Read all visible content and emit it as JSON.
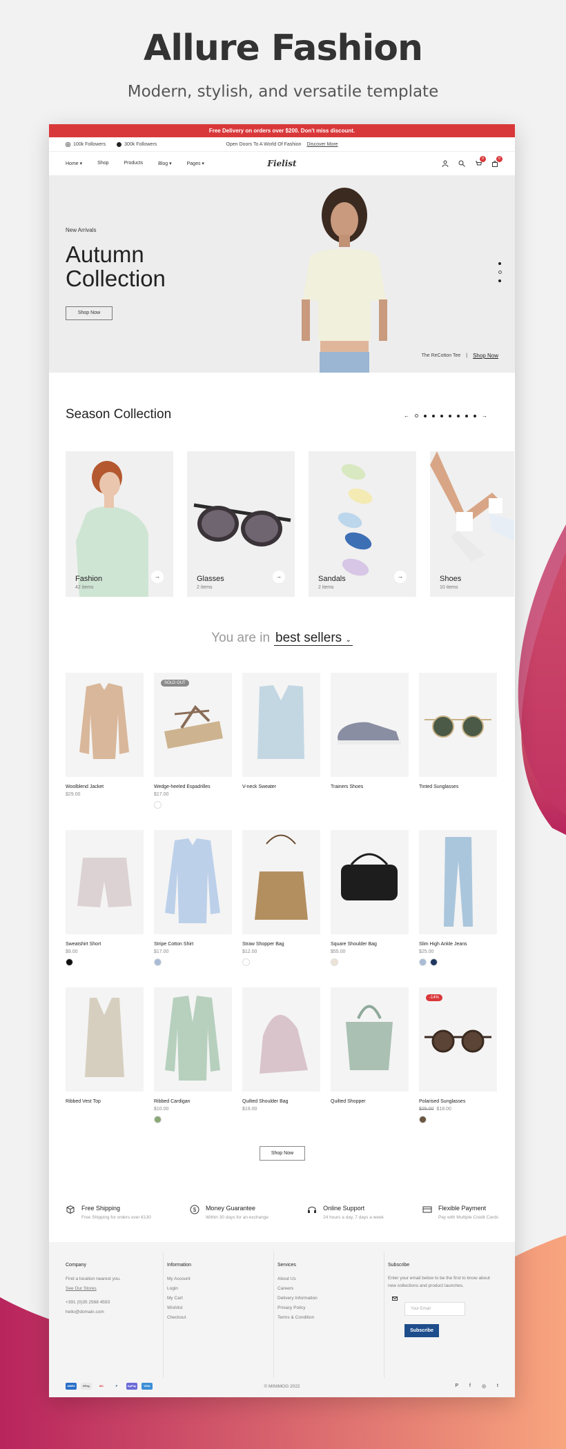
{
  "page": {
    "title": "Allure Fashion",
    "subtitle": "Modern, stylish, and versatile template"
  },
  "promo_bar": {
    "text": "Free Delivery on orders over $200. Don't miss discount."
  },
  "topbar": {
    "followers_1": "100k Followers",
    "followers_2": "300k Followers",
    "center_text": "Open Doors To A World Of Fashion",
    "center_link": "Discover More"
  },
  "nav": {
    "items": [
      "Home",
      "Shop",
      "Products",
      "Blog",
      "Pages"
    ],
    "logo": "Fielist",
    "wishlist_count": "0",
    "cart_count": "0"
  },
  "banner": {
    "eyebrow": "New Arrivals",
    "title_line1": "Autumn",
    "title_line2": "Collection",
    "button": "Shop Now",
    "caption": "The ReCotton Tee",
    "caption_link": "Shop Now"
  },
  "season": {
    "title": "Season Collection",
    "cards": [
      {
        "label": "Fashion",
        "count": "42 items"
      },
      {
        "label": "Glasses",
        "count": "2 items"
      },
      {
        "label": "Sandals",
        "count": "2 items"
      },
      {
        "label": "Shoes",
        "count": "10 items"
      }
    ]
  },
  "bestsellers": {
    "prefix": "You are in",
    "selected": "best sellers"
  },
  "products": [
    {
      "name": "Woolblend Jacket",
      "price": "$29.00",
      "icon": "jacket-icon",
      "swatches": []
    },
    {
      "name": "Wedge-heeled Espadrilles",
      "price": "$17.00",
      "icon": "espadrille-icon",
      "tag": "SOLD OUT",
      "swatches": [
        "#ffffff"
      ]
    },
    {
      "name": "V-neck Sweater",
      "price": "",
      "icon": "sweater-icon",
      "swatches": []
    },
    {
      "name": "Trainers Shoes",
      "price": "",
      "icon": "trainers-icon",
      "swatches": []
    },
    {
      "name": "Tinted Sunglasses",
      "price": "",
      "icon": "sunglasses-icon",
      "swatches": []
    },
    {
      "name": "Sweatshirt Short",
      "price": "$9.00",
      "icon": "shorts-icon",
      "swatches": [
        "#111111"
      ]
    },
    {
      "name": "Stripe Cotton Shirt",
      "price": "$17.00",
      "icon": "shirt-icon",
      "swatches": [
        "#a9bcd6"
      ]
    },
    {
      "name": "Straw Shopper Bag",
      "price": "$12.00",
      "icon": "straw-bag-icon",
      "swatches": [
        "#ffffff"
      ]
    },
    {
      "name": "Square Shoulder Bag",
      "price": "$55.00",
      "icon": "shoulder-bag-icon",
      "swatches": [
        "#ece3d6"
      ]
    },
    {
      "name": "Slim High Ankle Jeans",
      "price": "$25.00",
      "icon": "jeans-icon",
      "swatches": [
        "#a9bcd6",
        "#1f3761"
      ]
    },
    {
      "name": "Ribbed Vest Top",
      "price": "",
      "icon": "vest-icon",
      "swatches": []
    },
    {
      "name": "Ribbed Cardigan",
      "price": "$10.00",
      "icon": "cardigan-icon",
      "swatches": [
        "#8aa876"
      ]
    },
    {
      "name": "Quilted Shoulder Bag",
      "price": "$19.00",
      "icon": "quilted-bag-icon",
      "swatches": []
    },
    {
      "name": "Quilted Shopper",
      "price": "",
      "icon": "shopper-icon",
      "swatches": []
    },
    {
      "name": "Polarised Sunglasses",
      "price": "$18.00",
      "old_price": "$25.00",
      "icon": "polarised-icon",
      "tag": "-14%",
      "swatches": [
        "#6a5641"
      ]
    }
  ],
  "shop_now_button": "Shop Now",
  "features": [
    {
      "title": "Free Shipping",
      "desc": "Free Shipping for orders over €130",
      "icon": "box-icon"
    },
    {
      "title": "Money Guarantee",
      "desc": "Within 30 days for an exchange",
      "icon": "dollar-icon"
    },
    {
      "title": "Online Support",
      "desc": "24 hours a day, 7 days a week",
      "icon": "headset-icon"
    },
    {
      "title": "Flexible Payment",
      "desc": "Pay with Multiple Credit Cards",
      "icon": "card-icon"
    }
  ],
  "footer": {
    "company": {
      "title": "Company",
      "line1": "Find a location nearest you.",
      "link": "See Our Stores",
      "phone": "+391 (0)35 2568 4593",
      "email": "hello@domain.com"
    },
    "information": {
      "title": "Information",
      "items": [
        "My Account",
        "Login",
        "My Cart",
        "Wishlist",
        "Checkout"
      ]
    },
    "services": {
      "title": "Services",
      "items": [
        "About Us",
        "Careers",
        "Delivery Information",
        "Privacy Policy",
        "Terms & Condition"
      ]
    },
    "subscribe": {
      "title": "Subscribe",
      "text": "Enter your email below to be the first to know about new collections and product launches.",
      "placeholder": "Your Email",
      "button": "Subscribe"
    },
    "payments": [
      "AMEX",
      "GPay",
      "MC",
      "P",
      "ApPay",
      "VISA"
    ],
    "copyright": "© MINIMOG 2022",
    "social": [
      "pinterest-icon",
      "facebook-icon",
      "instagram-icon",
      "twitter-icon"
    ]
  },
  "colors": {
    "accent": "#d9383b",
    "subscribe": "#1e4d8c",
    "bg_gradient_start": "#f8a57e",
    "bg_gradient_end": "#b8245d"
  }
}
